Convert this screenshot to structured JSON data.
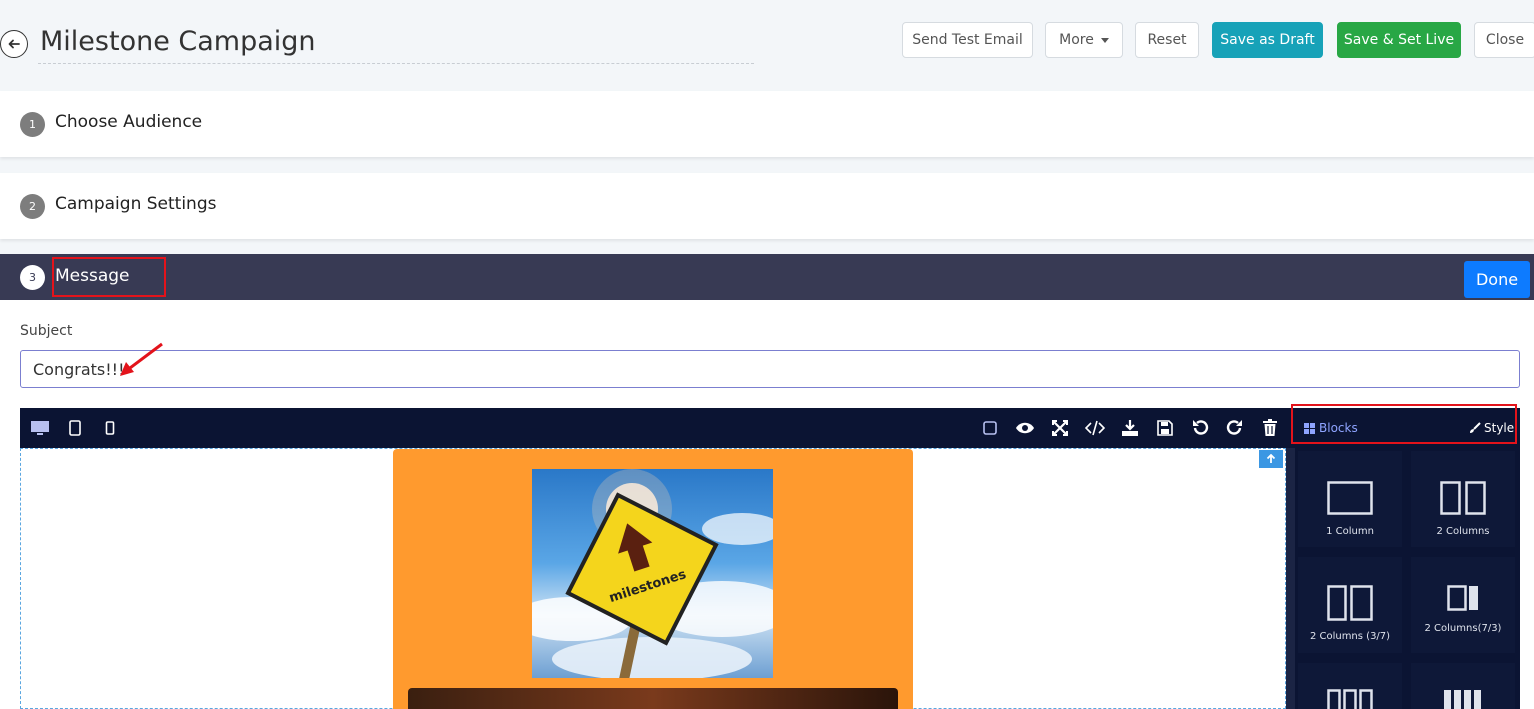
{
  "header": {
    "title": "Milestone Campaign",
    "buttons": {
      "send_test_email": "Send Test Email",
      "more": "More",
      "reset": "Reset",
      "save_draft": "Save as Draft",
      "save_live": "Save & Set Live",
      "close": "Close"
    }
  },
  "steps": [
    {
      "number": "1",
      "label": "Choose Audience"
    },
    {
      "number": "2",
      "label": "Campaign Settings"
    },
    {
      "number": "3",
      "label": "Message"
    }
  ],
  "message": {
    "done_label": "Done",
    "subject_label": "Subject",
    "subject_value": "Congrats!!!"
  },
  "editor": {
    "tabs": {
      "blocks": "Blocks",
      "style": "Style"
    },
    "sign_text": "milestones",
    "blocks": [
      {
        "label": "1 Column"
      },
      {
        "label": "2 Columns"
      },
      {
        "label": "2 Columns (3/7)"
      },
      {
        "label": "2 Columns(7/3)"
      }
    ]
  },
  "colors": {
    "accent_teal": "#17a2b8",
    "accent_green": "#28a745",
    "primary_blue": "#0d7bff",
    "highlight_red": "#e3131b",
    "card_orange": "#ff9a2e",
    "editor_dark": "#0b1433"
  }
}
